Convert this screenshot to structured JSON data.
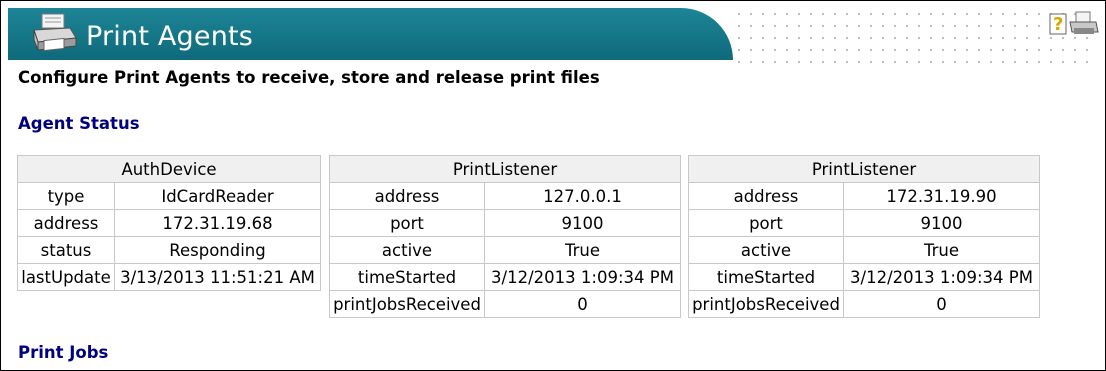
{
  "header": {
    "title": "Print Agents",
    "subtitle": "Configure Print Agents to receive, store and release print files",
    "logo_icon": "printer-icon",
    "help_icon": "help-icon",
    "print_icon": "print-page-icon"
  },
  "sections": {
    "agent_status": "Agent Status",
    "print_jobs": "Print Jobs"
  },
  "agents": [
    {
      "name": "AuthDevice",
      "rows": [
        {
          "key": "type",
          "value": "IdCardReader"
        },
        {
          "key": "address",
          "value": "172.31.19.68"
        },
        {
          "key": "status",
          "value": "Responding"
        },
        {
          "key": "lastUpdate",
          "value": "3/13/2013 11:51:21 AM"
        }
      ]
    },
    {
      "name": "PrintListener",
      "rows": [
        {
          "key": "address",
          "value": "127.0.0.1"
        },
        {
          "key": "port",
          "value": "9100"
        },
        {
          "key": "active",
          "value": "True"
        },
        {
          "key": "timeStarted",
          "value": "3/12/2013 1:09:34 PM"
        },
        {
          "key": "printJobsReceived",
          "value": "0"
        }
      ]
    },
    {
      "name": "PrintListener",
      "rows": [
        {
          "key": "address",
          "value": "172.31.19.90"
        },
        {
          "key": "port",
          "value": "9100"
        },
        {
          "key": "active",
          "value": "True"
        },
        {
          "key": "timeStarted",
          "value": "3/12/2013 1:09:34 PM"
        },
        {
          "key": "printJobsReceived",
          "value": "0"
        }
      ]
    }
  ],
  "colors": {
    "banner": "#127284",
    "section_heading": "#000080"
  }
}
